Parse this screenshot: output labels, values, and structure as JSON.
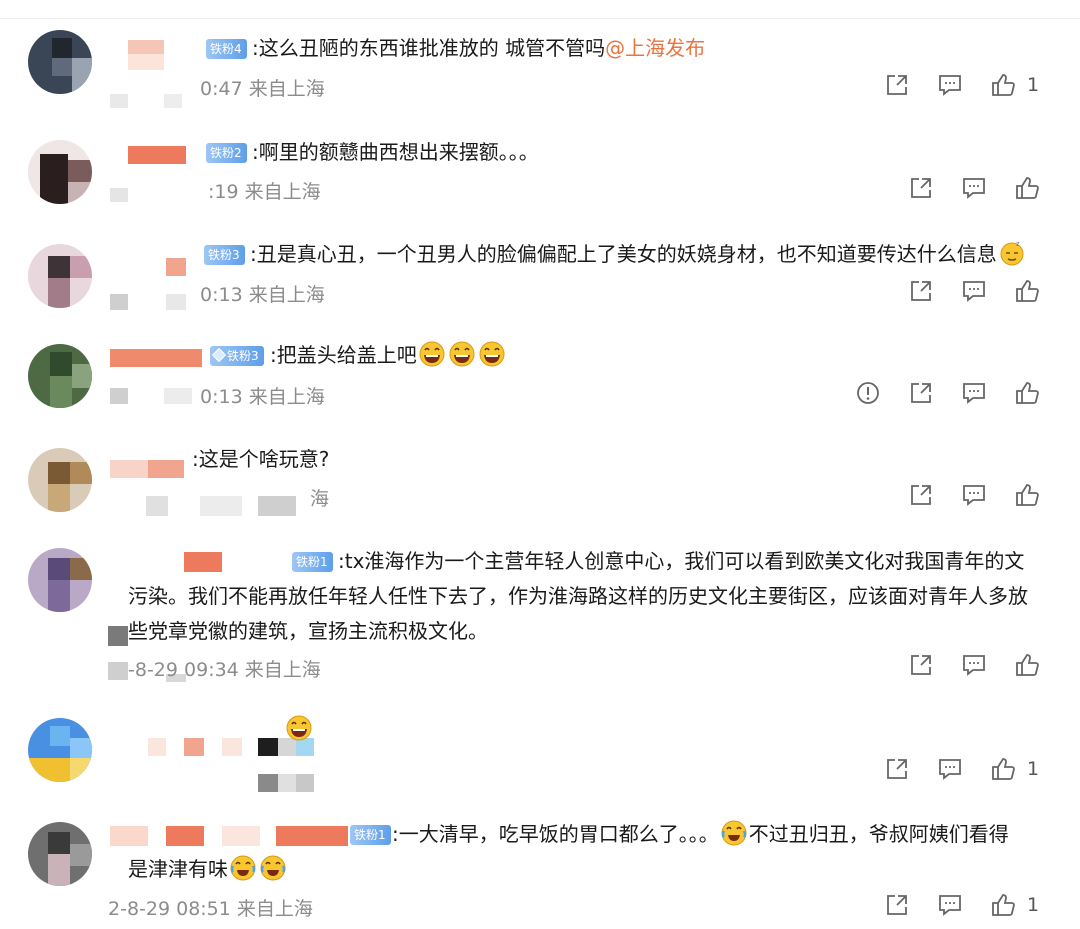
{
  "comments": [
    {
      "badge": "铁粉4",
      "text": ":这么丑陋的东西谁批准放的 城管不管吗",
      "mention": "@上海发布",
      "time": "0:47 来自上海",
      "like_count": "1"
    },
    {
      "badge": "铁粉2",
      "text": ":啊里的额戆曲西想出来摆额。。。",
      "time": ":19 来自上海",
      "like_count": ""
    },
    {
      "badge": "铁粉3",
      "text": ":丑是真心丑，一个丑男人的脸偏偏配上了美女的妖娆身材，也不知道要传达什么信息",
      "time": "0:13 来自上海",
      "like_count": ""
    },
    {
      "badge": "铁粉3",
      "text": ":把盖头给盖上吧",
      "time": "0:13 来自上海",
      "like_count": ""
    },
    {
      "badge": "",
      "text": ":这是个啥玩意?",
      "time": "海",
      "like_count": ""
    },
    {
      "badge": "铁粉1",
      "text_line1": ":tx淮海作为一个主营年轻人创意中心，我们可以看到欧美文化对我国青年的文",
      "text_line2": "污染。我们不能再放任年轻人任性下去了，作为淮海路这样的历史文化主要街区，应该面对青年人多放",
      "text_line3": "些党章党徽的建筑，宣扬主流积极文化。",
      "time": "-8-29 09:34 来自上海",
      "like_count": ""
    },
    {
      "badge": "",
      "text": "",
      "time": "",
      "like_count": "1"
    },
    {
      "badge": "铁粉1",
      "text_line1a": ":一大清早，吃早饭的胃口都么了。。。",
      "text_line1b": "不过丑归丑，爷叔阿姨们看得",
      "text_line2": "是津津有味",
      "time": "2-8-29 08:51 来自上海",
      "like_count": "1"
    }
  ],
  "icons": {
    "share": "share-icon",
    "comment": "comment-icon",
    "like": "thumbs-up-icon",
    "report": "report-icon"
  },
  "colors": {
    "mention": "#eb7340",
    "meta": "#8c8c8c",
    "badge": "#5e9fe9"
  }
}
